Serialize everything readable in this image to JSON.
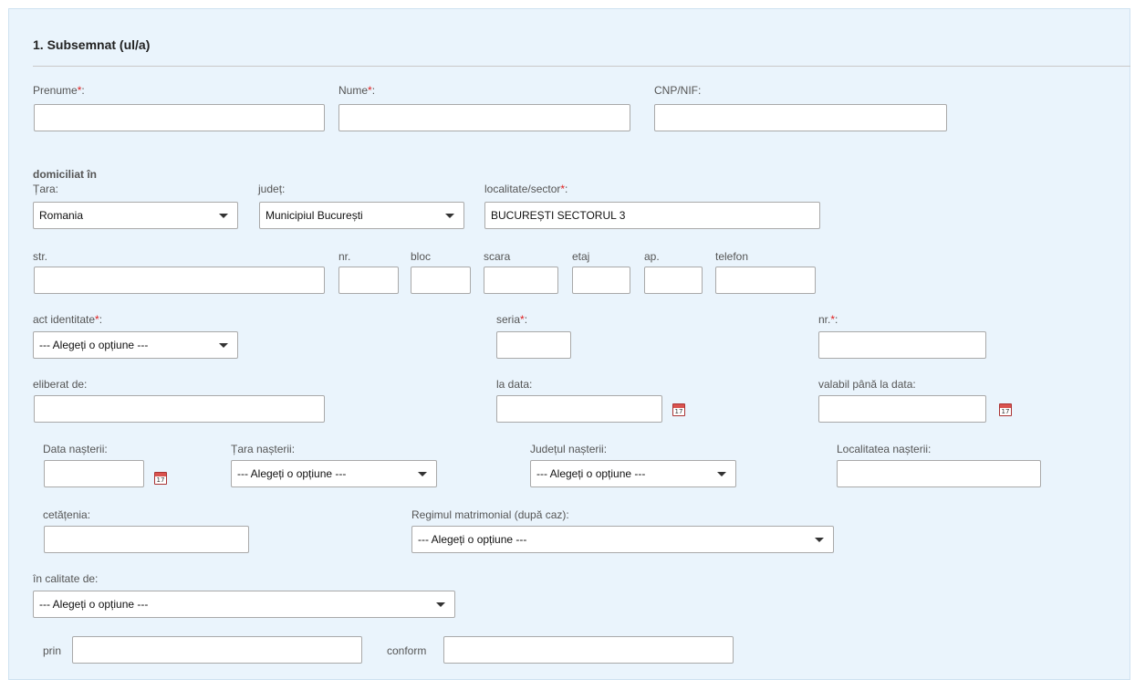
{
  "section": {
    "title": "1. Subsemnat (ul/a)"
  },
  "labels": {
    "prenume": "Prenume",
    "nume": "Nume",
    "cnp": "CNP/NIF:",
    "domiciliat": "domiciliat în",
    "tara": "Țara:",
    "judet": "județ:",
    "localitate": "localitate/sector",
    "str": "str.",
    "nr": "nr.",
    "bloc": "bloc",
    "scara": "scara",
    "etaj": "etaj",
    "ap": "ap.",
    "telefon": "telefon",
    "act": "act identitate",
    "seria": "seria",
    "nr_act": "nr.",
    "eliberat": "eliberat de:",
    "la_data": "la data:",
    "valabil": "valabil până la data:",
    "data_nasterii": "Data nașterii:",
    "tara_nasterii": "Țara nașterii:",
    "judetul_nasterii": "Județul nașterii:",
    "localitatea_nasterii": "Localitatea nașterii:",
    "cetatenia": "cetățenia:",
    "regim": "Regimul matrimonial (după caz):",
    "calitate": "în calitate de:",
    "prin": "prin",
    "conform": "conform"
  },
  "required_marker": "*",
  "colon": ":",
  "values": {
    "tara": "Romania",
    "judet": "Municipiul București",
    "localitate": "BUCUREȘTI SECTORUL 3",
    "placeholder_option": "--- Alegeți o opțiune ---"
  },
  "calendar_day": "17",
  "icons": {
    "calendar": "calendar-icon",
    "dropdown": "chevron-down-icon"
  },
  "colors": {
    "panel_bg": "#eaf4fc",
    "required": "#e02020"
  }
}
